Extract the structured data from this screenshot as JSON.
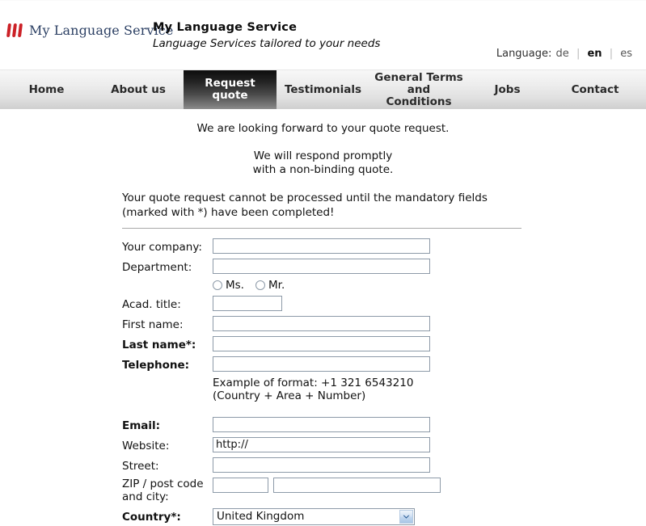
{
  "header": {
    "logo_text": "My Language Service",
    "logo_icon": "three-red-bars-logo",
    "brand_title": "My Language Service",
    "brand_tagline": "Language Services tailored to your needs",
    "language": {
      "label": "Language:",
      "options": [
        {
          "code": "de",
          "label": "de",
          "active": false
        },
        {
          "code": "en",
          "label": "en",
          "active": true
        },
        {
          "code": "es",
          "label": "es",
          "active": false
        }
      ],
      "separator": "|"
    }
  },
  "nav": {
    "items": [
      {
        "label": "Home",
        "active": false
      },
      {
        "label": "About us",
        "active": false
      },
      {
        "label": "Request quote",
        "active": true
      },
      {
        "label": "Testimonials",
        "active": false
      },
      {
        "label": "General Terms\nand Conditions",
        "active": false
      },
      {
        "label": "Jobs",
        "active": false
      },
      {
        "label": "Contact",
        "active": false
      }
    ]
  },
  "content": {
    "intro_line1": "We are looking forward to your quote request.",
    "intro_line2a": "We will respond promptly",
    "intro_line2b": "with a non-binding quote.",
    "notice": "Your quote request cannot be processed until the mandatory fields (marked with *) have been completed!"
  },
  "form": {
    "company": {
      "label": "Your company:",
      "value": "",
      "required": false
    },
    "department": {
      "label": "Department:",
      "value": "",
      "required": false
    },
    "salutation": {
      "options": [
        {
          "label": "Ms.",
          "checked": false
        },
        {
          "label": "Mr.",
          "checked": false
        }
      ]
    },
    "acad_title": {
      "label": "Acad. title:",
      "value": "",
      "required": false
    },
    "first_name": {
      "label": "First name:",
      "value": "",
      "required": false
    },
    "last_name": {
      "label": "Last name*:",
      "value": "",
      "required": true
    },
    "telephone": {
      "label": "Telephone:",
      "value": "",
      "required": true,
      "hint_line1": "Example of format: +1 321 6543210",
      "hint_line2": "(Country + Area + Number)"
    },
    "email": {
      "label": "Email:",
      "value": "",
      "required": true
    },
    "website": {
      "label": "Website:",
      "value": "http://",
      "required": false
    },
    "street": {
      "label": "Street:",
      "value": "",
      "required": false
    },
    "zip_city": {
      "label_line1": "ZIP / post code",
      "label_line2": "and city:",
      "zip_value": "",
      "city_value": ""
    },
    "country": {
      "label": "Country*:",
      "selected": "United Kingdom",
      "required": true,
      "arrow_icon": "chevron-down-icon"
    }
  },
  "colors": {
    "brand_red": "#cc2127",
    "logo_navy": "#2b3f63",
    "field_border": "#8d9aa8",
    "nav_active_bg": "#1a1a1a",
    "rule": "#a9a9a9"
  }
}
